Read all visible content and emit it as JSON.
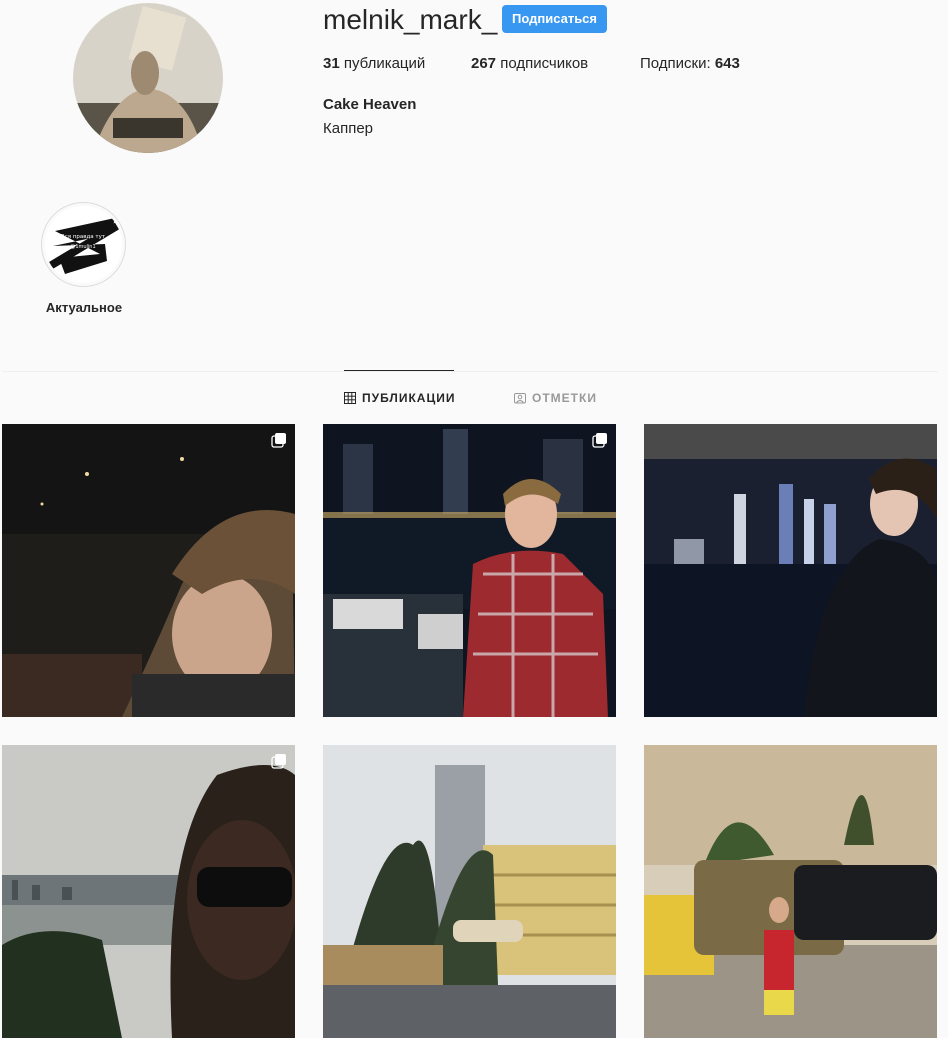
{
  "profile": {
    "username": "melnik_mark_",
    "follow_label": "Подписаться",
    "stats": {
      "posts_count": "31",
      "posts_label": " публикаций",
      "followers_count": "267",
      "followers_label": " подписчиков",
      "following_label": "Подписки: ",
      "following_count": "643"
    },
    "full_name": "Cake Heaven",
    "bio": "Каппер"
  },
  "highlights": [
    {
      "label": "Актуальное",
      "cover_text_1": "Вся правда тут",
      "cover_text_2": "@1mulin1"
    }
  ],
  "tabs": [
    {
      "label": "ПУБЛИКАЦИИ",
      "icon": "grid-icon",
      "active": true
    },
    {
      "label": "ОТМЕТКИ",
      "icon": "tag-icon",
      "active": false
    }
  ],
  "posts": [
    {
      "description": "night-balcony-portrait",
      "multi": true
    },
    {
      "description": "marina-night-plaid-shirt",
      "multi": true
    },
    {
      "description": "skyline-night-portrait",
      "multi": false
    },
    {
      "description": "sunglasses-selfie-sea",
      "multi": true
    },
    {
      "description": "palms-flags-hotel",
      "multi": false
    },
    {
      "description": "cars-street-red-shirt",
      "multi": false
    }
  ],
  "colors": {
    "accent": "#3897f0",
    "text": "#262626",
    "muted": "#999999",
    "background": "#fafafa"
  }
}
